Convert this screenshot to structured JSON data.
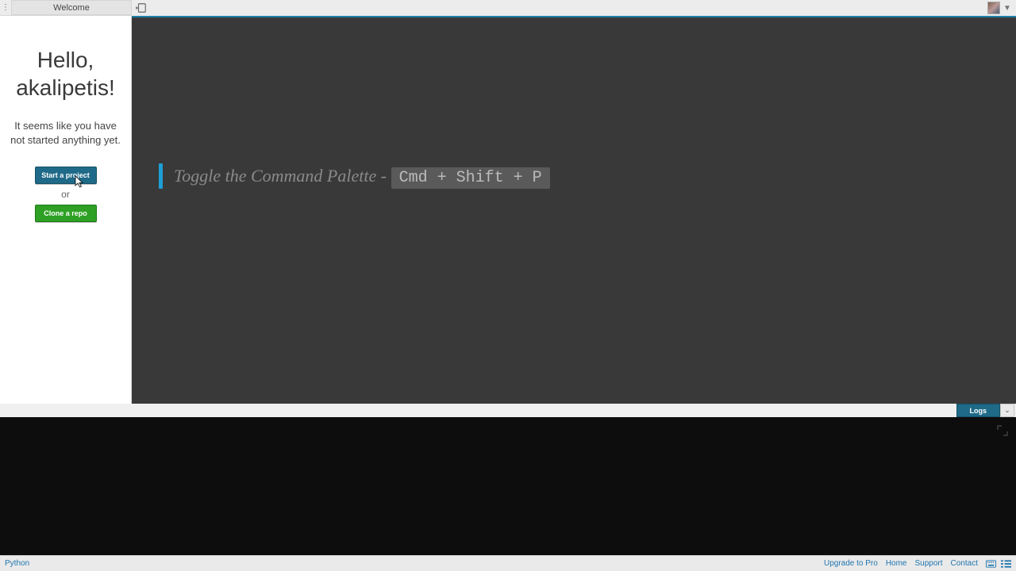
{
  "sidebar_tab": {
    "label": "Welcome"
  },
  "welcome": {
    "greeting": "Hello, akalipetis!",
    "subtext": "It seems like you have not started anything yet.",
    "start_label": "Start a project",
    "or_label": "or",
    "clone_label": "Clone a repo"
  },
  "editor_tip": {
    "text": "Toggle the Command Palette",
    "sep": " - ",
    "shortcut": "Cmd + Shift + P"
  },
  "logs_tab": {
    "label": "Logs"
  },
  "status": {
    "language": "Python",
    "links": {
      "upgrade": "Upgrade to Pro",
      "home": "Home",
      "support": "Support",
      "contact": "Contact"
    }
  },
  "colors": {
    "accent": "#1d7fa6",
    "editor_bg": "#393939",
    "console_bg": "#0d0d0d"
  }
}
